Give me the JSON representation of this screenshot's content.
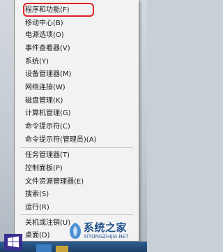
{
  "menu": {
    "items": [
      {
        "label": "程序和功能(F)"
      },
      {
        "label": "移动中心(B)"
      },
      {
        "label": "电源选项(O)"
      },
      {
        "label": "事件查看器(V)"
      },
      {
        "label": "系统(Y)"
      },
      {
        "label": "设备管理器(M)"
      },
      {
        "label": "网络连接(W)"
      },
      {
        "label": "磁盘管理(K)"
      },
      {
        "label": "计算机管理(G)"
      },
      {
        "label": "命令提示符(C)"
      },
      {
        "label": "命令提示符(管理员)(A)"
      },
      {
        "label": "任务管理器(T)"
      },
      {
        "label": "控制面板(P)"
      },
      {
        "label": "文件资源管理器(E)"
      },
      {
        "label": "搜索(S)"
      },
      {
        "label": "运行(R)"
      },
      {
        "label": "关机或注销(U)"
      },
      {
        "label": "桌面(D)"
      }
    ],
    "highlight_color": "#e0222a"
  },
  "watermark": {
    "title": "系统之家",
    "url": "XITONGZHIJIA.NET"
  },
  "taskbar": {
    "accent_color": "#1b3f68"
  }
}
